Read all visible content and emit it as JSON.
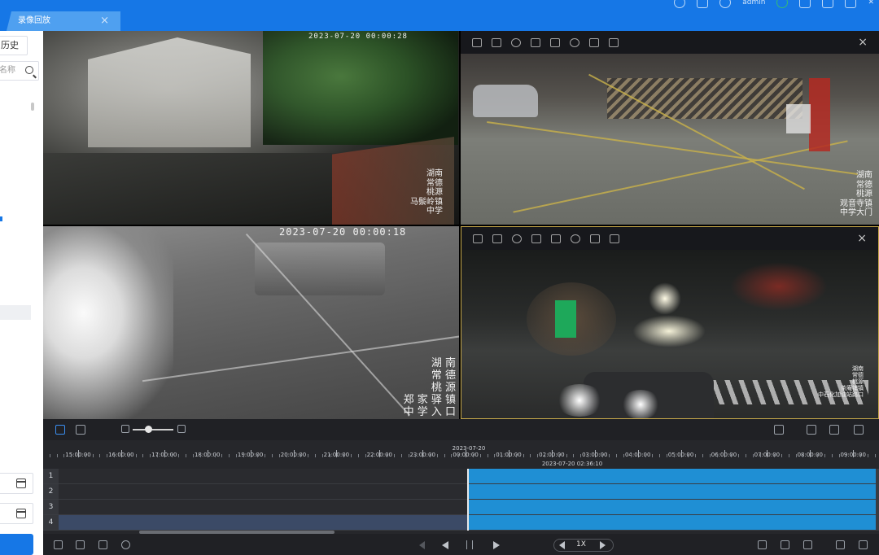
{
  "tab": {
    "label": "录像回放"
  },
  "topbar": {
    "user_label": "admin"
  },
  "sidebar": {
    "history_label": "历史",
    "search_placeholder": "名称"
  },
  "cameras": [
    {
      "timestamp": "2023-07-20 00:00:28",
      "location": [
        "湖南",
        "常德",
        "桃源",
        "马鬃岭镇",
        "中学"
      ]
    },
    {
      "timestamp": "",
      "location": [
        "湖南",
        "常德",
        "桃源",
        "观音寺镇",
        "中学大门"
      ]
    },
    {
      "timestamp": "2023-07-20 00:00:18",
      "location": [
        "湖 南",
        "常 德",
        "桃 源",
        "郑 家 驿 镇",
        "中 学 入 口"
      ]
    },
    {
      "timestamp": "",
      "location": [
        "湖南",
        "常德",
        "桃源",
        "茶庵铺镇",
        "中石化加油站路口"
      ]
    }
  ],
  "timeline": {
    "hours": [
      "15:00:00",
      "16:00:00",
      "17:00:00",
      "18:00:00",
      "19:00:00",
      "20:00:00",
      "21:00:00",
      "22:00:00",
      "23:00:00",
      "00:00:00",
      "01:00:00",
      "02:00:00",
      "03:00:00",
      "04:00:00",
      "05:00:00",
      "06:00:00",
      "07:00:00",
      "08:00:00",
      "09:00:00"
    ],
    "date_marker": "2023-07-20",
    "current_time": "2023-07-20 02:36:10",
    "tracks": [
      "1",
      "2",
      "3",
      "4"
    ],
    "speed": "1X"
  },
  "icons": {
    "video_toolbar": [
      "camera-icon",
      "record-icon",
      "zoom-icon",
      "stream-icon",
      "audio-icon",
      "ptz-icon",
      "pause-icon",
      "volume-icon"
    ],
    "close": "×"
  }
}
